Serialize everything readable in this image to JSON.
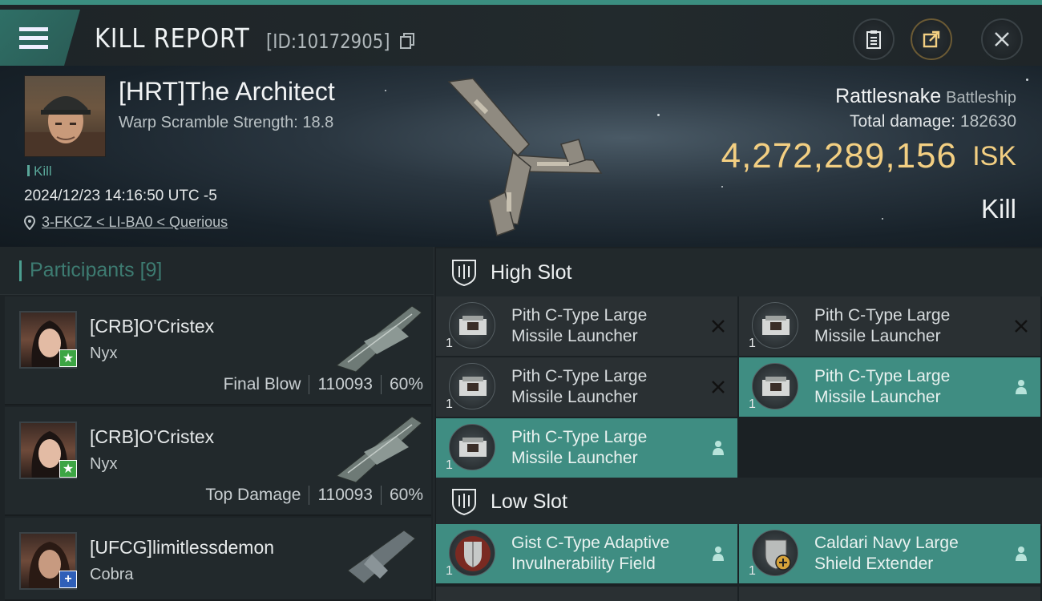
{
  "header": {
    "title": "KILL REPORT",
    "kill_id": "[ID:10172905]"
  },
  "victim": {
    "name": "[HRT]The Architect",
    "warp_scramble": "Warp Scramble Strength: 18.8",
    "tag": "Kill",
    "datetime": "2024/12/23 14:16:50 UTC -5",
    "location": "3-FKCZ < LI-BA0 < Querious",
    "ship_name": "Rattlesnake",
    "ship_class": "Battleship",
    "total_damage_label": "Total damage:",
    "total_damage_value": "182630",
    "isk_value": "4,272,289,156",
    "isk_label": "ISK",
    "result": "Kill"
  },
  "participants": {
    "label": "Participants",
    "count": "[9]",
    "rows": [
      {
        "name": "[CRB]O'Cristex",
        "ship": "Nyx",
        "role": "Final Blow",
        "damage": "110093",
        "percent": "60%"
      },
      {
        "name": "[CRB]O'Cristex",
        "ship": "Nyx",
        "role": "Top Damage",
        "damage": "110093",
        "percent": "60%"
      },
      {
        "name": "[UFCG]limitlessdemon",
        "ship": "Cobra",
        "role": "",
        "damage": "",
        "percent": ""
      }
    ]
  },
  "high_slot": {
    "label": "High Slot",
    "modules": [
      {
        "name_line1": "Pith C-Type Large",
        "name_line2": "Missile Launcher",
        "qty": "1",
        "status": "destroyed"
      },
      {
        "name_line1": "Pith C-Type Large",
        "name_line2": "Missile Launcher",
        "qty": "1",
        "status": "destroyed"
      },
      {
        "name_line1": "Pith C-Type Large",
        "name_line2": "Missile Launcher",
        "qty": "1",
        "status": "destroyed"
      },
      {
        "name_line1": "Pith C-Type Large",
        "name_line2": "Missile Launcher",
        "qty": "1",
        "status": "dropped"
      },
      {
        "name_line1": "Pith C-Type Large",
        "name_line2": "Missile Launcher",
        "qty": "1",
        "status": "dropped"
      }
    ]
  },
  "low_slot": {
    "label": "Low Slot",
    "modules": [
      {
        "name_line1": "Gist C-Type Adaptive",
        "name_line2": "Invulnerability Field",
        "qty": "1",
        "status": "dropped"
      },
      {
        "name_line1": "Caldari Navy Large",
        "name_line2": "Shield Extender",
        "qty": "1",
        "status": "dropped"
      }
    ]
  },
  "colors": {
    "accent": "#3f8d82",
    "isk": "#f3cf82",
    "module_bg": "#2a3033"
  }
}
